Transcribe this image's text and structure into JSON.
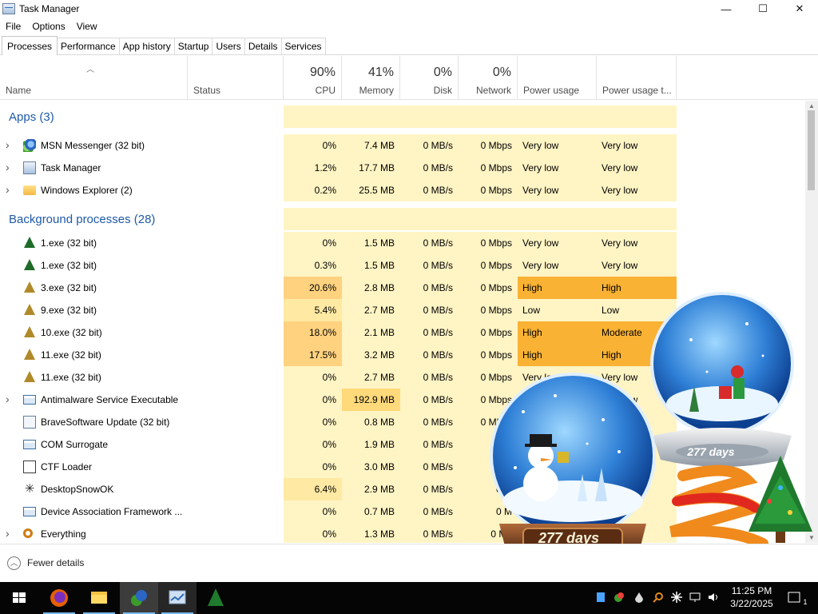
{
  "window": {
    "title": "Task Manager",
    "controls": {
      "minimize": "—",
      "maximize": "☐",
      "close": "✕"
    }
  },
  "menu": [
    "File",
    "Options",
    "View"
  ],
  "tabs": [
    "Processes",
    "Performance",
    "App history",
    "Startup",
    "Users",
    "Details",
    "Services"
  ],
  "columns": {
    "name": "Name",
    "status": "Status",
    "cpu": {
      "pct": "90%",
      "label": "CPU"
    },
    "memory": {
      "pct": "41%",
      "label": "Memory"
    },
    "disk": {
      "pct": "0%",
      "label": "Disk"
    },
    "network": {
      "pct": "0%",
      "label": "Network"
    },
    "power": "Power usage",
    "power_trend": "Power usage t..."
  },
  "groups": {
    "apps": "Apps (3)",
    "background": "Background processes (28)"
  },
  "apps": [
    {
      "name": "MSN Messenger (32 bit)",
      "icon": "msn-icon",
      "cpu": "0%",
      "memory": "7.4 MB",
      "disk": "0 MB/s",
      "network": "0 Mbps",
      "power": "Very low",
      "trend": "Very low",
      "level": "low",
      "expandable": true
    },
    {
      "name": "Task Manager",
      "icon": "task-manager-icon",
      "cpu": "1.2%",
      "memory": "17.7 MB",
      "disk": "0 MB/s",
      "network": "0 Mbps",
      "power": "Very low",
      "trend": "Very low",
      "level": "low",
      "expandable": true
    },
    {
      "name": "Windows Explorer (2)",
      "icon": "folder-icon",
      "cpu": "0.2%",
      "memory": "25.5 MB",
      "disk": "0 MB/s",
      "network": "0 Mbps",
      "power": "Very low",
      "trend": "Very low",
      "level": "low",
      "expandable": true
    }
  ],
  "background": [
    {
      "name": "1.exe (32 bit)",
      "icon": "tree-icon",
      "cpu": "0%",
      "memory": "1.5 MB",
      "disk": "0 MB/s",
      "network": "0 Mbps",
      "power": "Very low",
      "trend": "Very low",
      "level": "low",
      "expandable": false
    },
    {
      "name": "1.exe (32 bit)",
      "icon": "tree-icon",
      "cpu": "0.3%",
      "memory": "1.5 MB",
      "disk": "0 MB/s",
      "network": "0 Mbps",
      "power": "Very low",
      "trend": "Very low",
      "level": "low",
      "expandable": false
    },
    {
      "name": "3.exe (32 bit)",
      "icon": "gold-tree-icon",
      "cpu": "20.6%",
      "memory": "2.8 MB",
      "disk": "0 MB/s",
      "network": "0 Mbps",
      "power": "High",
      "trend": "High",
      "level": "high",
      "expandable": false
    },
    {
      "name": "9.exe (32 bit)",
      "icon": "gold-tree-icon",
      "cpu": "5.4%",
      "memory": "2.7 MB",
      "disk": "0 MB/s",
      "network": "0 Mbps",
      "power": "Low",
      "trend": "Low",
      "level": "mid",
      "expandable": false
    },
    {
      "name": "10.exe (32 bit)",
      "icon": "gold-tree-icon",
      "cpu": "18.0%",
      "memory": "2.1 MB",
      "disk": "0 MB/s",
      "network": "0 Mbps",
      "power": "High",
      "trend": "Moderate",
      "level": "high",
      "expandable": false
    },
    {
      "name": "11.exe (32 bit)",
      "icon": "gold-tree-icon",
      "cpu": "17.5%",
      "memory": "3.2 MB",
      "disk": "0 MB/s",
      "network": "0 Mbps",
      "power": "High",
      "trend": "High",
      "level": "high",
      "expandable": false
    },
    {
      "name": "11.exe (32 bit)",
      "icon": "gold-tree-icon",
      "cpu": "0%",
      "memory": "2.7 MB",
      "disk": "0 MB/s",
      "network": "0 Mbps",
      "power": "Very low",
      "trend": "Very low",
      "level": "low",
      "expandable": false
    },
    {
      "name": "Antimalware Service Executable",
      "icon": "service-icon",
      "cpu": "0%",
      "memory": "192.9 MB",
      "disk": "0 MB/s",
      "network": "0 Mbps",
      "power": "Very low",
      "trend": "Very low",
      "level": "memhigh",
      "expandable": true
    },
    {
      "name": "BraveSoftware Update (32 bit)",
      "icon": "brave-update-icon",
      "cpu": "0%",
      "memory": "0.8 MB",
      "disk": "0 MB/s",
      "network": "0 Mbps",
      "power": "",
      "trend": "",
      "level": "low",
      "expandable": false
    },
    {
      "name": "COM Surrogate",
      "icon": "service-icon",
      "cpu": "0%",
      "memory": "1.9 MB",
      "disk": "0 MB/s",
      "network": "0 M",
      "power": "",
      "trend": "",
      "level": "low",
      "expandable": false
    },
    {
      "name": "CTF Loader",
      "icon": "ctf-icon",
      "cpu": "0%",
      "memory": "3.0 MB",
      "disk": "0 MB/s",
      "network": "0 M",
      "power": "",
      "trend": "",
      "level": "low",
      "expandable": false
    },
    {
      "name": "DesktopSnowOK",
      "icon": "snowflake-icon",
      "cpu": "6.4%",
      "memory": "2.9 MB",
      "disk": "0 MB/s",
      "network": "0 M",
      "power": "",
      "trend": "",
      "level": "mid",
      "expandable": false
    },
    {
      "name": "Device Association Framework ...",
      "icon": "service-icon",
      "cpu": "0%",
      "memory": "0.7 MB",
      "disk": "0 MB/s",
      "network": "0 M",
      "power": "",
      "trend": "",
      "level": "low",
      "expandable": false
    },
    {
      "name": "Everything",
      "icon": "search-icon",
      "cpu": "0%",
      "memory": "1.3 MB",
      "disk": "0 MB/s",
      "network": "0 Mb",
      "power": "",
      "trend": "",
      "level": "low",
      "expandable": true
    }
  ],
  "footer": {
    "fewer_details": "Fewer details"
  },
  "overlay": {
    "days_small": "277 days",
    "days_big": "277 days"
  },
  "taskbar": {
    "time": "11:25 PM",
    "date": "3/22/2025",
    "notification_count": "1"
  },
  "colors": {
    "low": "#fff4c4",
    "mid": "#ffe9a3",
    "high": "#f9b233",
    "cpu_high": "#ffd27f",
    "mem_high": "#ffd97a",
    "accent": "#1e5aa8"
  }
}
